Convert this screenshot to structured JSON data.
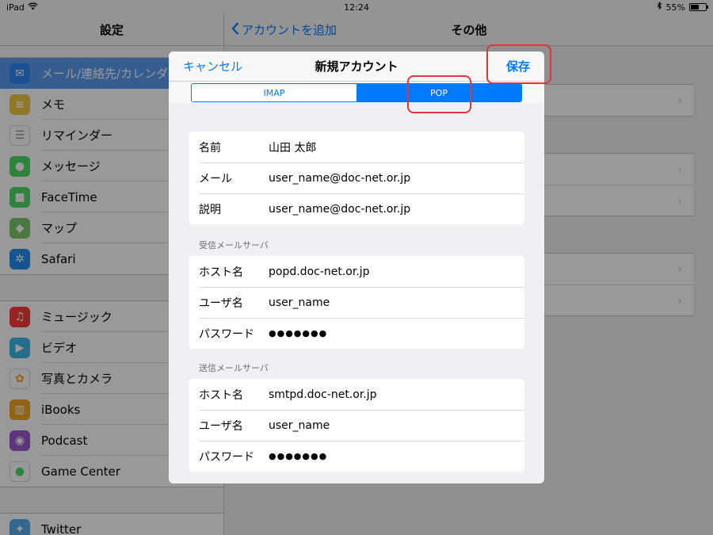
{
  "status": {
    "device": "iPad",
    "time": "12:24",
    "battery": "55%",
    "battery_level": 0.55
  },
  "sidebar": {
    "title": "設定",
    "groups": [
      [
        {
          "label": "メール/連絡先/カレンダー",
          "icon": "mail-icon",
          "color": "#2f86f4",
          "selected": true
        },
        {
          "label": "メモ",
          "icon": "notes-icon",
          "color": "#f5c645"
        },
        {
          "label": "リマインダー",
          "icon": "reminders-icon",
          "color": "#ffffff"
        },
        {
          "label": "メッセージ",
          "icon": "messages-icon",
          "color": "#4cd964"
        },
        {
          "label": "FaceTime",
          "icon": "facetime-icon",
          "color": "#4cd964"
        },
        {
          "label": "マップ",
          "icon": "maps-icon",
          "color": "#7ec66b"
        },
        {
          "label": "Safari",
          "icon": "safari-icon",
          "color": "#1f8ef1"
        }
      ],
      [
        {
          "label": "ミュージック",
          "icon": "music-icon",
          "color": "#fc3d39"
        },
        {
          "label": "ビデオ",
          "icon": "video-icon",
          "color": "#3ab8e8"
        },
        {
          "label": "写真とカメラ",
          "icon": "photos-icon",
          "color": "#ffffff"
        },
        {
          "label": "iBooks",
          "icon": "ibooks-icon",
          "color": "#f5a623"
        },
        {
          "label": "Podcast",
          "icon": "podcast-icon",
          "color": "#9b59d0"
        },
        {
          "label": "Game Center",
          "icon": "game-center-icon",
          "color": "#ffffff"
        }
      ],
      [
        {
          "label": "Twitter",
          "icon": "twitter-icon",
          "color": "#55acee"
        }
      ]
    ]
  },
  "detail": {
    "back_label": "アカウントを追加",
    "title": "その他"
  },
  "modal": {
    "cancel_label": "キャンセル",
    "title": "新規アカウント",
    "save_label": "保存",
    "segments": [
      "IMAP",
      "POP"
    ],
    "active_segment": "POP",
    "account": [
      {
        "label": "名前",
        "value": "山田 太郎"
      },
      {
        "label": "メール",
        "value": "user_name@doc-net.or.jp"
      },
      {
        "label": "説明",
        "value": "user_name@doc-net.or.jp"
      }
    ],
    "incoming": {
      "header": "受信メールサーバ",
      "rows": [
        {
          "label": "ホスト名",
          "value": "popd.doc-net.or.jp"
        },
        {
          "label": "ユーザ名",
          "value": "user_name"
        },
        {
          "label": "パスワード",
          "value": "●●●●●●●"
        }
      ]
    },
    "outgoing": {
      "header": "送信メールサーバ",
      "rows": [
        {
          "label": "ホスト名",
          "value": "smtpd.doc-net.or.jp"
        },
        {
          "label": "ユーザ名",
          "value": "user_name"
        },
        {
          "label": "パスワード",
          "value": "●●●●●●●"
        }
      ]
    }
  },
  "colors": {
    "accent": "#007aff",
    "highlight": "#e0363a"
  }
}
